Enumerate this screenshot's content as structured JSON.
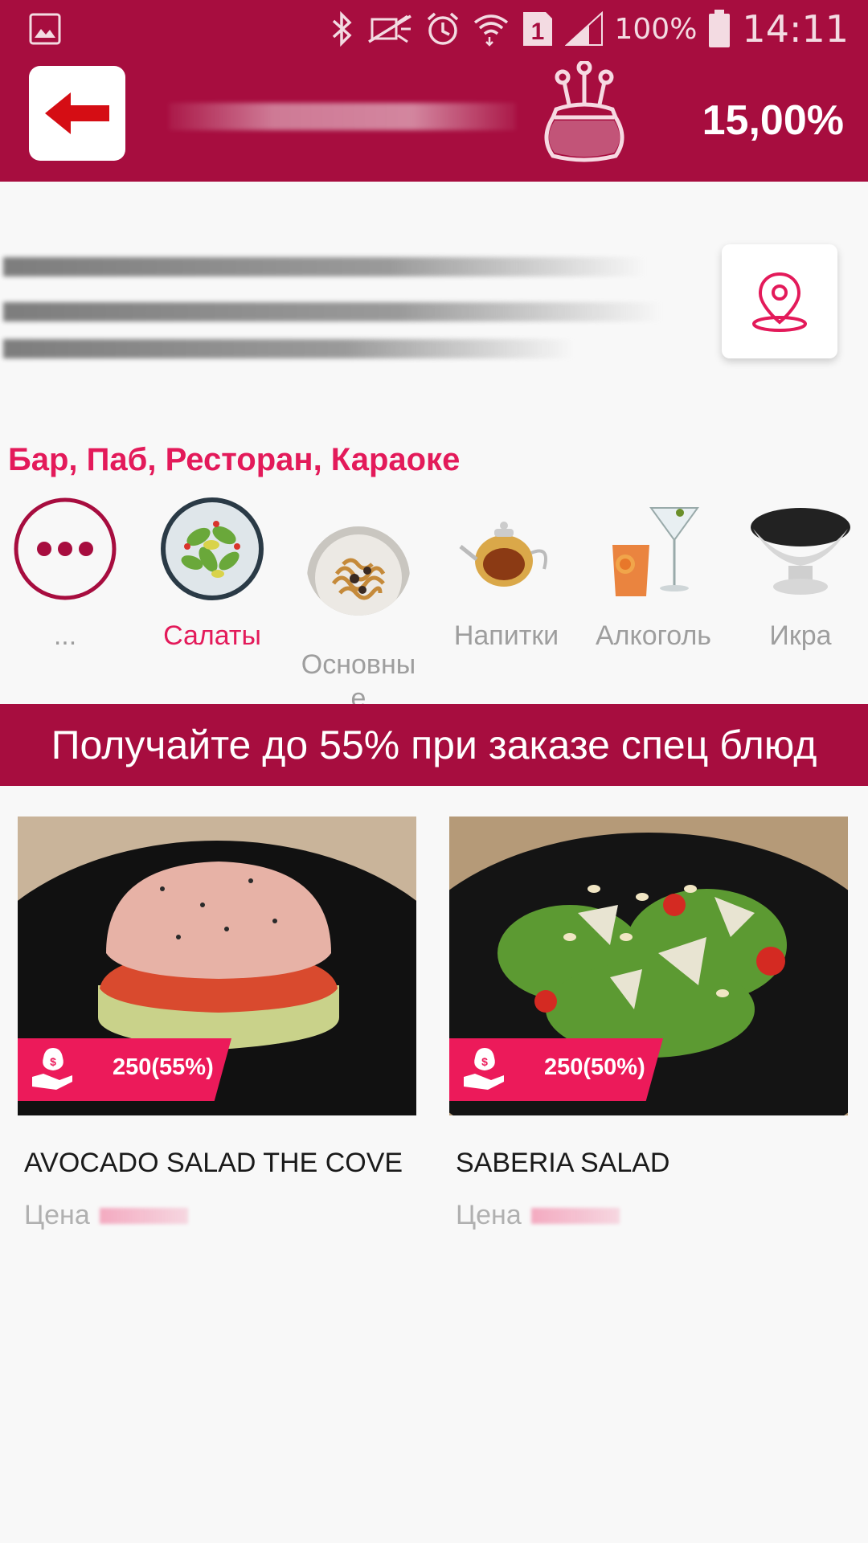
{
  "status_bar": {
    "battery": "100%",
    "time": "14:11",
    "sim_slot": "1",
    "icons": [
      "image-icon",
      "bluetooth-icon",
      "mute-icon",
      "alarm-icon",
      "wifi-icon",
      "signal-icon",
      "battery-icon"
    ]
  },
  "header": {
    "back_icon": "arrow-left-icon",
    "wallet_icon": "purse-icon",
    "cashback_percent": "15,00%",
    "accent_color": "#a70d3f"
  },
  "venue": {
    "map_icon": "map-pin-icon",
    "category_tags": "Бар, Паб, Ресторан, Караоке"
  },
  "categories": [
    {
      "label": "...",
      "icon": "more-dots-icon",
      "active": false
    },
    {
      "label": "Салаты",
      "icon": "salad-icon",
      "active": true
    },
    {
      "label": "Основны\nе",
      "icon": "pasta-icon",
      "active": false
    },
    {
      "label": "Напитки",
      "icon": "teapot-icon",
      "active": false
    },
    {
      "label": "Алкоголь",
      "icon": "cocktail-icon",
      "active": false
    },
    {
      "label": "Икра",
      "icon": "caviar-icon",
      "active": false
    }
  ],
  "promo_banner": "Получайте до 55% при заказе спец блюд",
  "products": [
    {
      "title": "AVOCADO SALAD THE COVE",
      "bonus": "250(55%)",
      "price_label": "Цена"
    },
    {
      "title": "SABERIA SALAD",
      "bonus": "250(50%)",
      "price_label": "Цена"
    }
  ]
}
